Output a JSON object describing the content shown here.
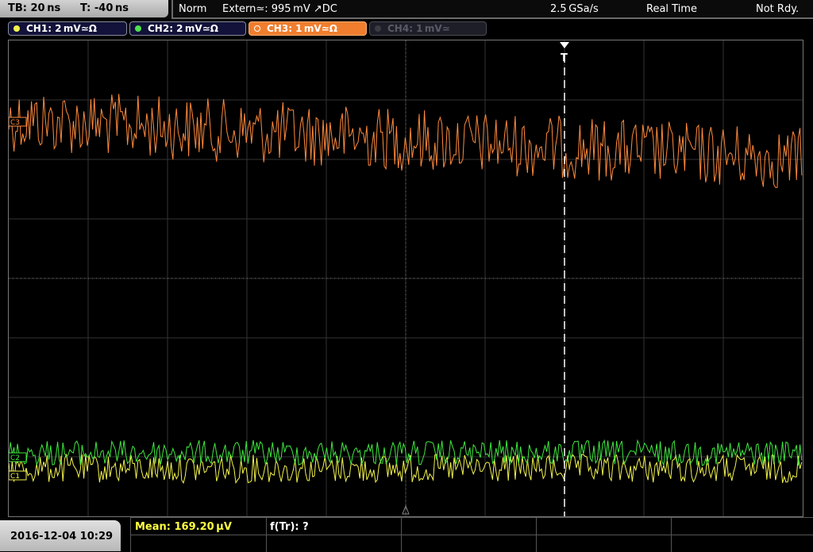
{
  "timebase": {
    "tb_label": "TB: 20 ns",
    "t_label": "T: -40 ns"
  },
  "status": {
    "mode": "Norm",
    "trigger": "Extern≃: 995 mV ↗DC",
    "sample_rate": "2.5 GSa/s",
    "acq": "Real Time",
    "state": "Not Rdy."
  },
  "channels": [
    {
      "id": "CH1",
      "label": "CH1: 2 mV≃Ω",
      "color": "#f3f34c",
      "active": true
    },
    {
      "id": "CH2",
      "label": "CH2: 2 mV≃Ω",
      "color": "#4fe04f",
      "active": true
    },
    {
      "id": "CH3",
      "label": "CH3: 1 mV≃Ω",
      "color": "#ff8a3c",
      "active": true,
      "selected": true
    },
    {
      "id": "CH4",
      "label": "CH4: 1 mV≃",
      "color": "#555560",
      "active": false
    }
  ],
  "markers": {
    "ch3": "C3",
    "ch2": "C2",
    "ch1": "C1",
    "trigger": "T"
  },
  "measurements": {
    "mean": "Mean: 169.20 µV",
    "ftr": "f(Tr): ?"
  },
  "datetime": "2016-12-04 10:29",
  "colors": {
    "ch1": "#f3f34c",
    "ch2": "#3fe83f",
    "ch3": "#ff8a3c",
    "grid": "#3a3a3a",
    "meas_yellow": "#ffff40"
  }
}
